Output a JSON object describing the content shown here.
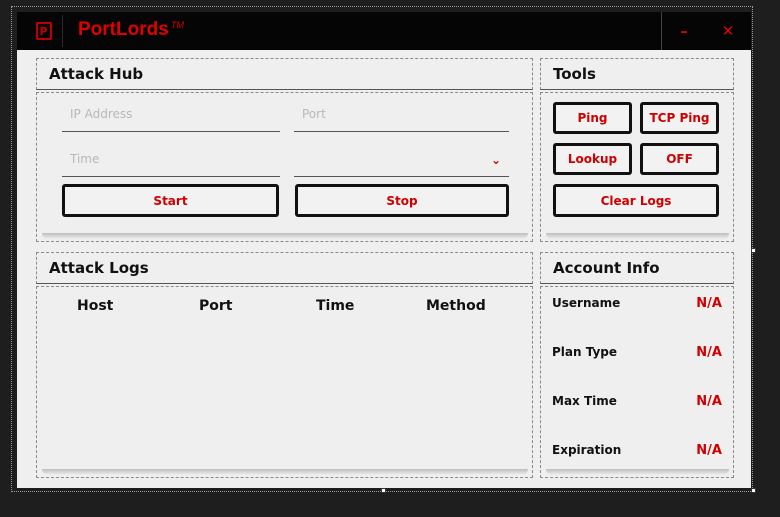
{
  "app": {
    "title": "PortLords",
    "trademark": "TM",
    "logo_letter": "P"
  },
  "window_controls": {
    "minimize": "–",
    "close": "✕"
  },
  "attack_hub": {
    "title": "Attack Hub",
    "ip_placeholder": "IP Address",
    "port_placeholder": "Port",
    "time_placeholder": "Time",
    "method_value": "",
    "start_label": "Start",
    "stop_label": "Stop"
  },
  "tools": {
    "title": "Tools",
    "ping": "Ping",
    "tcp_ping": "TCP Ping",
    "lookup": "Lookup",
    "off": "OFF",
    "clear_logs": "Clear Logs"
  },
  "attack_logs": {
    "title": "Attack Logs",
    "columns": [
      "Host",
      "Port",
      "Time",
      "Method"
    ]
  },
  "account_info": {
    "title": "Account Info",
    "rows": [
      {
        "label": "Username",
        "value": "N/A"
      },
      {
        "label": "Plan Type",
        "value": "N/A"
      },
      {
        "label": "Max Time",
        "value": "N/A"
      },
      {
        "label": "Expiration",
        "value": "N/A"
      }
    ]
  },
  "colors": {
    "accent": "#d00000",
    "titlebar": "#050505",
    "panel_bg": "#efefef"
  }
}
